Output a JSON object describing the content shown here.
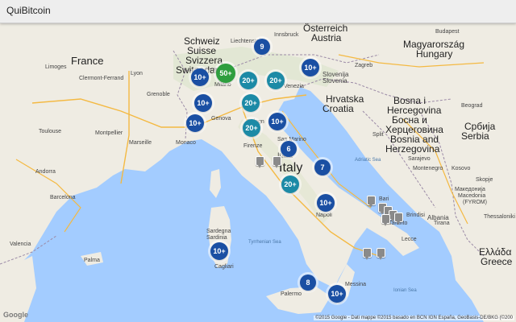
{
  "app": {
    "title": "QuiBitcoin"
  },
  "colors": {
    "cluster_blue": "#1a4fa3",
    "cluster_teal": "#1c8aa6",
    "cluster_green": "#2e9e3e",
    "land": "#efece3",
    "sea": "#a3ccff"
  },
  "map": {
    "countries": {
      "france": "France",
      "schweiz": "Schweiz",
      "suisse": "Suisse",
      "svizzera": "Svizzera",
      "switzerland": "Switzerland",
      "liechtenstein": "Liechtenstein",
      "osterreich": "Österreich",
      "austria": "Austria",
      "magyarorszag": "Magyarország",
      "hungary": "Hungary",
      "slovenija": "Slovenija",
      "slovenia": "Slovenia",
      "hrvatska": "Hrvatska",
      "croatia": "Croatia",
      "bih1": "Bosna i",
      "bih2": "Hercegovina",
      "bih3": "Босна и",
      "bih4": "Херцеговина",
      "bih5": "Bosnia and",
      "bih6": "Herzegovina",
      "srbija": "Србија",
      "serbia": "Serbia",
      "montenegro": "Montenegro",
      "kosovo": "Kosovo",
      "macedonia1": "Македонија",
      "macedonia2": "Macedonia",
      "macedonia3": "(FYROM)",
      "albania": "Albania",
      "ellada": "Ελλάδα",
      "greece": "Greece",
      "italy": "Italy",
      "italia": "Italia"
    },
    "cities": {
      "limoges": "Limoges",
      "clermont": "Clermont-Ferrand",
      "lyon": "Lyon",
      "grenoble": "Grenoble",
      "montpellier": "Montpellier",
      "marseille": "Marseille",
      "toulouse": "Toulouse",
      "andorra": "Andorra",
      "barcelona": "Barcelona",
      "valencia": "Valencia",
      "palma": "Palma",
      "monaco": "Monaco",
      "genova": "Genova",
      "milano": "Milano",
      "bologna": "Bologn",
      "firenze": "Firenze",
      "sanmarino": "San Marino",
      "innsbruck": "Innsbruck",
      "venezia": "Venezia",
      "napoli": "Napoli",
      "bari": "Bari",
      "taranto": "Taranto",
      "brindisi": "Brindisi",
      "lecce": "Lecce",
      "palermo": "Palermo",
      "messina": "Messina",
      "sardegna": "Sardegna",
      "sardinia": "Sardinia",
      "cagliari": "Cagliari",
      "sarajevo": "Sarajevo",
      "beograd": "Beograd",
      "budapest": "Budapest",
      "zagreb": "Zagreb",
      "split": "Split",
      "tirana": "Tirana",
      "skopje": "Skopje",
      "thessaloniki": "Thessaloniki"
    },
    "seas": {
      "tyrrhenian": "Tyrrhenian Sea",
      "adriatic": "Adriatic Sea",
      "ionian": "Ionian Sea"
    },
    "clusters": [
      {
        "label": "9",
        "color": "blue"
      },
      {
        "label": "10+",
        "color": "blue"
      },
      {
        "label": "50+",
        "color": "green"
      },
      {
        "label": "10+",
        "color": "blue"
      },
      {
        "label": "20+",
        "color": "teal"
      },
      {
        "label": "20+",
        "color": "teal"
      },
      {
        "label": "10+",
        "color": "blue"
      },
      {
        "label": "20+",
        "color": "teal"
      },
      {
        "label": "10+",
        "color": "blue"
      },
      {
        "label": "20+",
        "color": "teal"
      },
      {
        "label": "10+",
        "color": "blue"
      },
      {
        "label": "6",
        "color": "blue"
      },
      {
        "label": "7",
        "color": "blue"
      },
      {
        "label": "20+",
        "color": "teal"
      },
      {
        "label": "10+",
        "color": "blue"
      },
      {
        "label": "10+",
        "color": "blue"
      },
      {
        "label": "8",
        "color": "blue"
      },
      {
        "label": "10+",
        "color": "blue"
      }
    ],
    "google_logo": "Google",
    "attribution": "©2015 Google - Dati mappe ©2015 basado en BCN IGN España, GeoBasis-DE/BKG (©200"
  }
}
